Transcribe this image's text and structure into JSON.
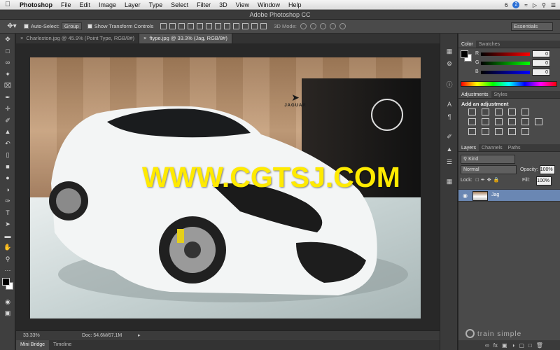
{
  "menubar": {
    "app": "Photoshop",
    "items": [
      "File",
      "Edit",
      "Image",
      "Layer",
      "Type",
      "Select",
      "Filter",
      "3D",
      "View",
      "Window",
      "Help"
    ],
    "status_num": "6",
    "badge": "2"
  },
  "titlebar": {
    "title": "Adobe Photoshop CC"
  },
  "options": {
    "auto_select": "Auto-Select:",
    "group": "Group",
    "show_transform": "Show Transform Controls",
    "mode3d": "3D Mode:",
    "workspace": "Essentials"
  },
  "tabs": [
    {
      "label": "Charleston.jpg @ 45.9% (Point Type, RGB/8#)"
    },
    {
      "label": "ftype.jpg @ 33.3% (Jag, RGB/8#)"
    }
  ],
  "canvas": {
    "watermark": "WWW.CGTSJ.COM",
    "brand": "JAGUAR"
  },
  "status": {
    "zoom": "33.33%",
    "doc": "Doc: 54.6M/67.1M"
  },
  "bottom_tabs": [
    "Mini Bridge",
    "Timeline"
  ],
  "color_panel": {
    "tabs": [
      "Color",
      "Swatches"
    ],
    "rows": [
      {
        "label": "R",
        "value": "0",
        "color": "#ff0000"
      },
      {
        "label": "G",
        "value": "0",
        "color": "#00ff00"
      },
      {
        "label": "B",
        "value": "0",
        "color": "#0000ff"
      }
    ]
  },
  "adjustments_panel": {
    "tabs": [
      "Adjustments",
      "Styles"
    ],
    "title": "Add an adjustment"
  },
  "layers_panel": {
    "tabs": [
      "Layers",
      "Channels",
      "Paths"
    ],
    "kind": "Kind",
    "blend": "Normal",
    "opacity_label": "Opacity:",
    "opacity": "100%",
    "lock_label": "Lock:",
    "fill_label": "Fill:",
    "fill": "100%",
    "layers": [
      {
        "name": "Jag"
      }
    ]
  },
  "watermark_logo": "train simple",
  "colors": {
    "accent_layer": "#6a87b3",
    "watermark": "#ffea00"
  }
}
